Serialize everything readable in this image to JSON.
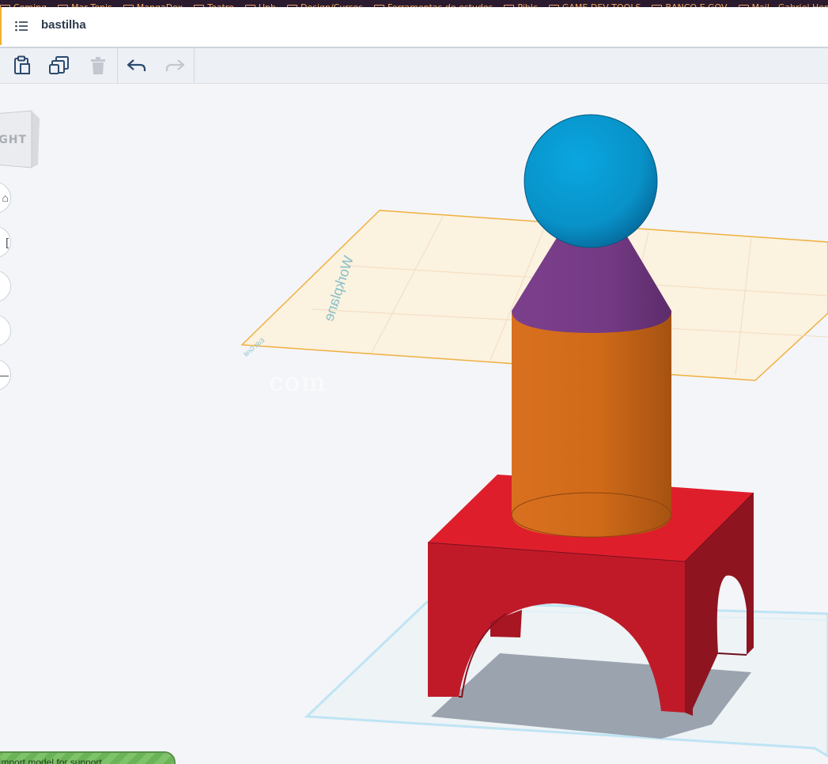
{
  "bookmarks": [
    "Coming",
    "Mar Tenis",
    "MangaDex",
    "Teatro",
    "Unb",
    "Design/Cursos",
    "Ferramentas de estudos",
    "Piblc",
    "GAME DEV TOOLS",
    "BANCO E GOV",
    "Mail - Gabriel Henrique"
  ],
  "titlebar": {
    "title": "bastilha"
  },
  "toolbar": {
    "copy_icon": "clipboard-icon",
    "duplicate_icon": "duplicate-icon",
    "delete_icon": "trash-icon",
    "undo_icon": "undo-icon",
    "redo_icon": "redo-icon"
  },
  "viewcube": {
    "label": "IGHT"
  },
  "zoom_controls": [
    {
      "icon": "home-icon",
      "glyph": "⌂"
    },
    {
      "icon": "fit-icon",
      "glyph": "["
    },
    {
      "icon": "zoom-in-icon",
      "glyph": ""
    },
    {
      "icon": "zoom-out-icon",
      "glyph": ""
    },
    {
      "icon": "ortho-icon",
      "glyph": "—"
    }
  ],
  "workplane": {
    "label": "Workplane",
    "snap_label": "Edit Grid"
  },
  "watermark": "    com",
  "bottom_banner": {
    "text": "Import model for support"
  },
  "colors": {
    "sphere": "#0a8fc8",
    "cone": "#7a3d8a",
    "cylinder": "#d86e1c",
    "box": "#c41a28",
    "workplane": "#f0b040",
    "grid": "#b8dff0"
  }
}
